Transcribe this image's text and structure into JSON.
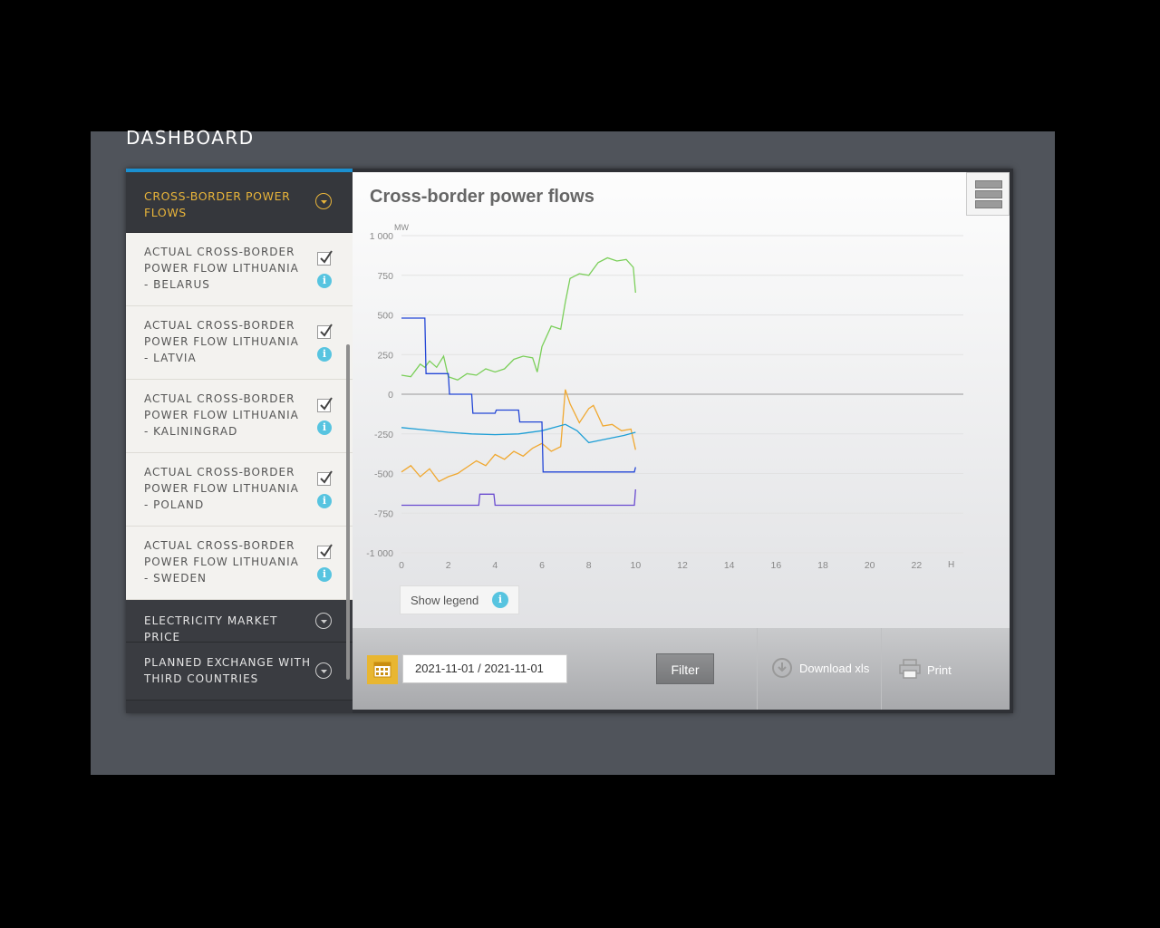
{
  "page": {
    "title": "DASHBOARD"
  },
  "sidebar": {
    "header": {
      "label": "CROSS-BORDER POWER FLOWS"
    },
    "items": [
      {
        "label": "ACTUAL CROSS-BORDER POWER FLOW LITHUANIA - BELARUS",
        "checked": true
      },
      {
        "label": "ACTUAL CROSS-BORDER POWER FLOW LITHUANIA - LATVIA",
        "checked": true
      },
      {
        "label": "ACTUAL CROSS-BORDER POWER FLOW LITHUANIA - KALININGRAD",
        "checked": true
      },
      {
        "label": "ACTUAL CROSS-BORDER POWER FLOW LITHUANIA - POLAND",
        "checked": true
      },
      {
        "label": "ACTUAL CROSS-BORDER POWER FLOW LITHUANIA - SWEDEN",
        "checked": true
      }
    ],
    "categories": [
      {
        "label": "ELECTRICITY MARKET PRICE"
      },
      {
        "label": "PLANNED EXCHANGE WITH THIRD COUNTRIES"
      }
    ],
    "info_glyph": "i"
  },
  "colors": {
    "accent": "#e8b43a",
    "top_border": "#1a8fd0",
    "info": "#57c4e0"
  },
  "chart": {
    "title": "Cross-border power flows",
    "legend_button": "Show legend"
  },
  "chart_data": {
    "type": "line",
    "title": "Cross-border power flows",
    "ylabel": "MW",
    "xlabel": "H",
    "xlim": [
      0,
      24
    ],
    "ylim": [
      -1000,
      1000
    ],
    "xticks": [
      0,
      2,
      4,
      6,
      8,
      10,
      12,
      14,
      16,
      18,
      20,
      22
    ],
    "yticks": [
      1000,
      750,
      500,
      250,
      0,
      -250,
      -500,
      -750,
      -1000
    ],
    "ytick_labels": [
      "1 000",
      "750",
      "500",
      "250",
      "0",
      "-250",
      "-500",
      "-750",
      "-1 000"
    ],
    "xtick_labels": [
      "0",
      "2",
      "4",
      "6",
      "8",
      "10",
      "12",
      "14",
      "16",
      "18",
      "20",
      "22"
    ],
    "grid": true,
    "series": [
      {
        "color": "#7bcf5a",
        "x": [
          0,
          0.4,
          0.8,
          1,
          1.2,
          1.5,
          1.8,
          2,
          2.4,
          2.8,
          3.2,
          3.6,
          4,
          4.4,
          4.8,
          5.2,
          5.6,
          5.8,
          6,
          6.4,
          6.8,
          7,
          7.2,
          7.6,
          8,
          8.4,
          8.8,
          9.2,
          9.6,
          9.9,
          10
        ],
        "y": [
          120,
          110,
          190,
          170,
          210,
          170,
          240,
          110,
          90,
          130,
          120,
          160,
          140,
          160,
          220,
          240,
          230,
          140,
          300,
          430,
          410,
          580,
          730,
          760,
          750,
          830,
          860,
          840,
          850,
          800,
          640
        ]
      },
      {
        "color": "#f0a830",
        "x": [
          0,
          0.4,
          0.8,
          1.2,
          1.6,
          2,
          2.4,
          2.8,
          3.2,
          3.6,
          4,
          4.4,
          4.8,
          5.2,
          5.6,
          6,
          6.4,
          6.8,
          7,
          7.2,
          7.6,
          8,
          8.2,
          8.6,
          9,
          9.4,
          9.8,
          10
        ],
        "y": [
          -490,
          -450,
          -520,
          -470,
          -550,
          -520,
          -500,
          -460,
          -420,
          -450,
          -380,
          -410,
          -360,
          -390,
          -340,
          -310,
          -360,
          -330,
          30,
          -60,
          -180,
          -90,
          -70,
          -200,
          -190,
          -230,
          -220,
          -350
        ]
      },
      {
        "color": "#1f9fd6",
        "x": [
          0,
          1,
          2,
          3,
          4,
          5,
          6,
          7,
          7.5,
          8,
          8.5,
          9,
          9.5,
          10
        ],
        "y": [
          -210,
          -225,
          -240,
          -250,
          -255,
          -250,
          -230,
          -190,
          -230,
          -305,
          -290,
          -275,
          -260,
          -240
        ]
      },
      {
        "color": "#2346d6",
        "x": [
          0,
          1,
          1.05,
          2,
          2.05,
          3,
          3.05,
          4,
          4.05,
          5,
          5.05,
          6,
          6.05,
          7,
          8,
          9,
          9.95,
          10
        ],
        "y": [
          480,
          480,
          130,
          130,
          0,
          0,
          -120,
          -120,
          -100,
          -100,
          -175,
          -175,
          -490,
          -490,
          -490,
          -490,
          -490,
          -460
        ]
      },
      {
        "color": "#6a4bd0",
        "x": [
          0,
          1,
          2,
          3,
          3.3,
          3.35,
          3.95,
          4,
          5,
          6,
          7,
          8,
          9,
          9.95,
          10
        ],
        "y": [
          -700,
          -700,
          -700,
          -700,
          -700,
          -630,
          -630,
          -700,
          -700,
          -700,
          -700,
          -700,
          -700,
          -700,
          -600
        ]
      }
    ]
  },
  "toolbar": {
    "date_range": "2021-11-01 / 2021-11-01",
    "filter_label": "Filter",
    "download_label": "Download xls",
    "print_label": "Print"
  }
}
